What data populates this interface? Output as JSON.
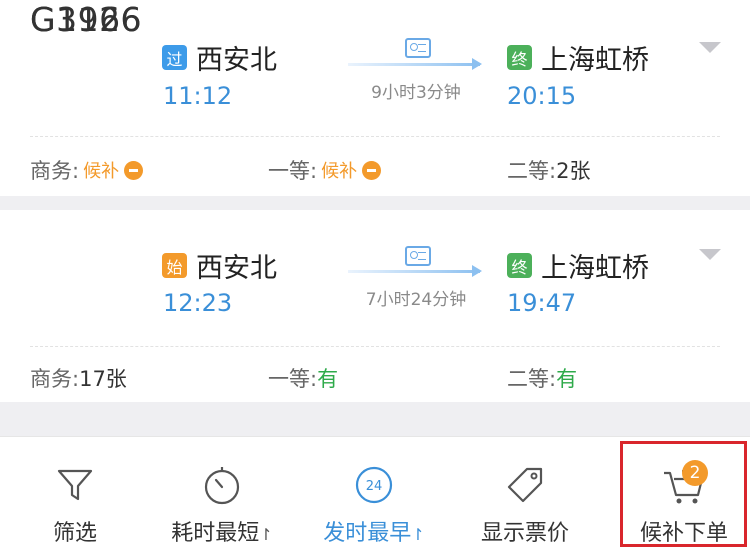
{
  "trains": [
    {
      "number": "G3166",
      "from_tag": "过",
      "from_station": "西安北",
      "depart_time": "11:12",
      "duration": "9小时3分钟",
      "to_tag": "终",
      "to_station": "上海虹桥",
      "arrive_time": "20:15",
      "seats": [
        {
          "label": "商务:",
          "value": "候补"
        },
        {
          "label": "一等:",
          "value": "候补"
        },
        {
          "label": "二等:",
          "value": "2张"
        }
      ]
    },
    {
      "number": "G1926",
      "from_tag": "始",
      "from_station": "西安北",
      "depart_time": "12:23",
      "duration": "7小时24分钟",
      "to_tag": "终",
      "to_station": "上海虹桥",
      "arrive_time": "19:47",
      "seats": [
        {
          "label": "商务:",
          "value": "17张"
        },
        {
          "label": "一等:",
          "value": "有"
        },
        {
          "label": "二等:",
          "value": "有"
        }
      ]
    }
  ],
  "toolbar": {
    "filter_label": "筛选",
    "shortest_label": "耗时最短",
    "earliest_label": "发时最早",
    "earliest_icon_text": "24",
    "price_label": "显示票价",
    "waitlist_label": "候补下单",
    "waitlist_count": "2"
  },
  "colors": {
    "accent_blue": "#3a8fd8",
    "orange": "#f39a2b",
    "green": "#2eaa4a",
    "highlight_red": "#d9262c"
  },
  "icons": [
    "id-card-icon",
    "filter-icon",
    "stopwatch-icon",
    "clock-24-icon",
    "price-tag-icon",
    "cart-icon",
    "expand-arrow-icon"
  ]
}
